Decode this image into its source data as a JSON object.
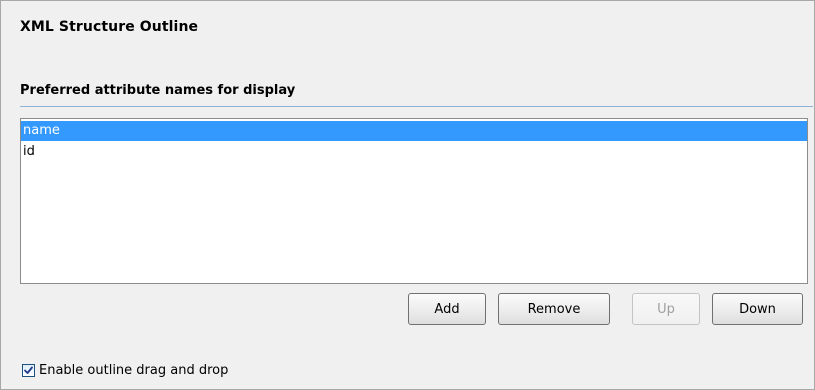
{
  "page": {
    "title": "XML Structure Outline"
  },
  "section": {
    "title": "Preferred attribute names for display"
  },
  "attribute_list": {
    "items": [
      {
        "label": "name",
        "selected": true
      },
      {
        "label": "id",
        "selected": false
      }
    ]
  },
  "buttons": {
    "add": {
      "label": "Add",
      "enabled": true
    },
    "remove": {
      "label": "Remove",
      "enabled": true
    },
    "up": {
      "label": "Up",
      "enabled": false
    },
    "down": {
      "label": "Down",
      "enabled": true
    }
  },
  "options": {
    "drag_drop": {
      "label": "Enable outline drag and drop",
      "checked": true
    }
  },
  "colors": {
    "selection": "#3399ff",
    "rule": "#8fb2d5",
    "background": "#f0f0f0"
  }
}
